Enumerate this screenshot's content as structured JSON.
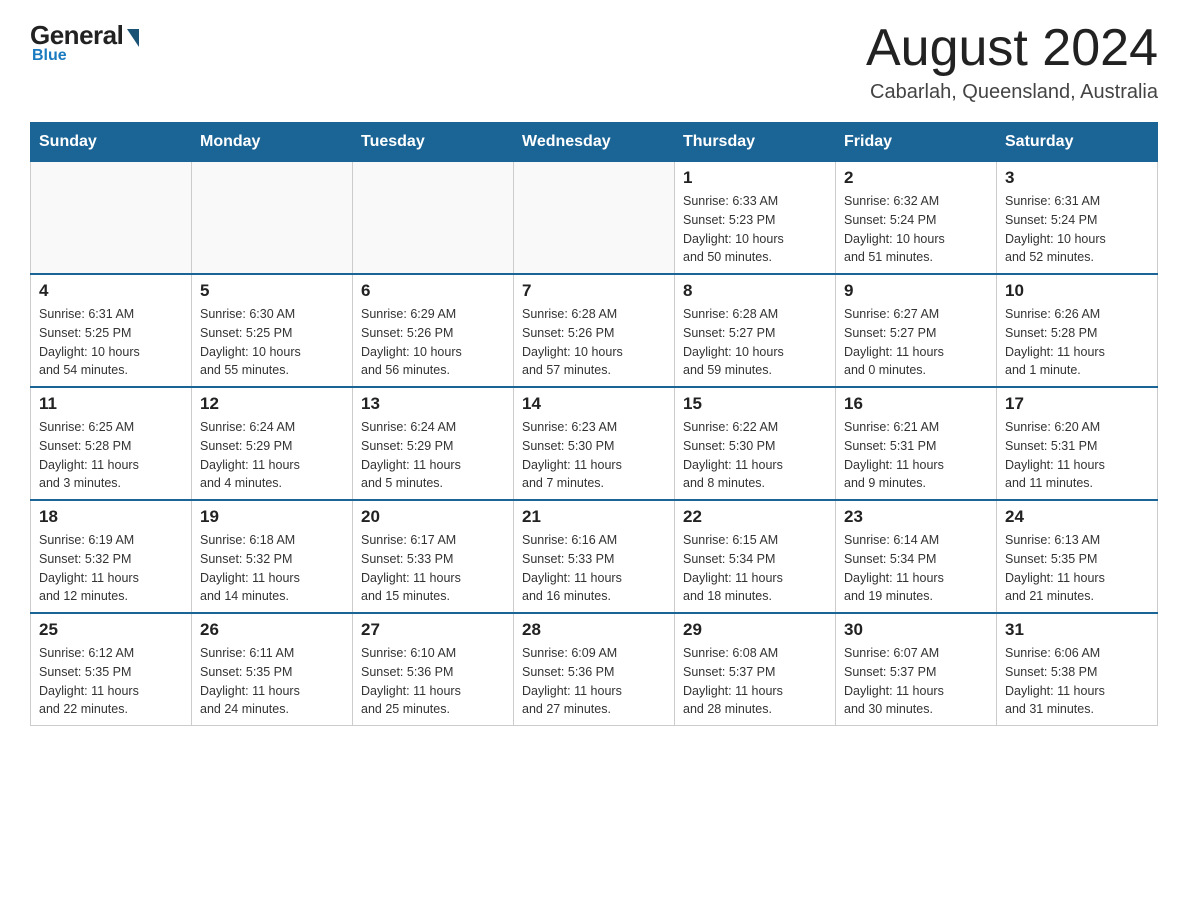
{
  "logo": {
    "general": "General",
    "blue": "Blue",
    "tagline": "Blue"
  },
  "header": {
    "month_year": "August 2024",
    "location": "Cabarlah, Queensland, Australia"
  },
  "days_of_week": [
    "Sunday",
    "Monday",
    "Tuesday",
    "Wednesday",
    "Thursday",
    "Friday",
    "Saturday"
  ],
  "weeks": [
    [
      {
        "day": "",
        "info": ""
      },
      {
        "day": "",
        "info": ""
      },
      {
        "day": "",
        "info": ""
      },
      {
        "day": "",
        "info": ""
      },
      {
        "day": "1",
        "info": "Sunrise: 6:33 AM\nSunset: 5:23 PM\nDaylight: 10 hours\nand 50 minutes."
      },
      {
        "day": "2",
        "info": "Sunrise: 6:32 AM\nSunset: 5:24 PM\nDaylight: 10 hours\nand 51 minutes."
      },
      {
        "day": "3",
        "info": "Sunrise: 6:31 AM\nSunset: 5:24 PM\nDaylight: 10 hours\nand 52 minutes."
      }
    ],
    [
      {
        "day": "4",
        "info": "Sunrise: 6:31 AM\nSunset: 5:25 PM\nDaylight: 10 hours\nand 54 minutes."
      },
      {
        "day": "5",
        "info": "Sunrise: 6:30 AM\nSunset: 5:25 PM\nDaylight: 10 hours\nand 55 minutes."
      },
      {
        "day": "6",
        "info": "Sunrise: 6:29 AM\nSunset: 5:26 PM\nDaylight: 10 hours\nand 56 minutes."
      },
      {
        "day": "7",
        "info": "Sunrise: 6:28 AM\nSunset: 5:26 PM\nDaylight: 10 hours\nand 57 minutes."
      },
      {
        "day": "8",
        "info": "Sunrise: 6:28 AM\nSunset: 5:27 PM\nDaylight: 10 hours\nand 59 minutes."
      },
      {
        "day": "9",
        "info": "Sunrise: 6:27 AM\nSunset: 5:27 PM\nDaylight: 11 hours\nand 0 minutes."
      },
      {
        "day": "10",
        "info": "Sunrise: 6:26 AM\nSunset: 5:28 PM\nDaylight: 11 hours\nand 1 minute."
      }
    ],
    [
      {
        "day": "11",
        "info": "Sunrise: 6:25 AM\nSunset: 5:28 PM\nDaylight: 11 hours\nand 3 minutes."
      },
      {
        "day": "12",
        "info": "Sunrise: 6:24 AM\nSunset: 5:29 PM\nDaylight: 11 hours\nand 4 minutes."
      },
      {
        "day": "13",
        "info": "Sunrise: 6:24 AM\nSunset: 5:29 PM\nDaylight: 11 hours\nand 5 minutes."
      },
      {
        "day": "14",
        "info": "Sunrise: 6:23 AM\nSunset: 5:30 PM\nDaylight: 11 hours\nand 7 minutes."
      },
      {
        "day": "15",
        "info": "Sunrise: 6:22 AM\nSunset: 5:30 PM\nDaylight: 11 hours\nand 8 minutes."
      },
      {
        "day": "16",
        "info": "Sunrise: 6:21 AM\nSunset: 5:31 PM\nDaylight: 11 hours\nand 9 minutes."
      },
      {
        "day": "17",
        "info": "Sunrise: 6:20 AM\nSunset: 5:31 PM\nDaylight: 11 hours\nand 11 minutes."
      }
    ],
    [
      {
        "day": "18",
        "info": "Sunrise: 6:19 AM\nSunset: 5:32 PM\nDaylight: 11 hours\nand 12 minutes."
      },
      {
        "day": "19",
        "info": "Sunrise: 6:18 AM\nSunset: 5:32 PM\nDaylight: 11 hours\nand 14 minutes."
      },
      {
        "day": "20",
        "info": "Sunrise: 6:17 AM\nSunset: 5:33 PM\nDaylight: 11 hours\nand 15 minutes."
      },
      {
        "day": "21",
        "info": "Sunrise: 6:16 AM\nSunset: 5:33 PM\nDaylight: 11 hours\nand 16 minutes."
      },
      {
        "day": "22",
        "info": "Sunrise: 6:15 AM\nSunset: 5:34 PM\nDaylight: 11 hours\nand 18 minutes."
      },
      {
        "day": "23",
        "info": "Sunrise: 6:14 AM\nSunset: 5:34 PM\nDaylight: 11 hours\nand 19 minutes."
      },
      {
        "day": "24",
        "info": "Sunrise: 6:13 AM\nSunset: 5:35 PM\nDaylight: 11 hours\nand 21 minutes."
      }
    ],
    [
      {
        "day": "25",
        "info": "Sunrise: 6:12 AM\nSunset: 5:35 PM\nDaylight: 11 hours\nand 22 minutes."
      },
      {
        "day": "26",
        "info": "Sunrise: 6:11 AM\nSunset: 5:35 PM\nDaylight: 11 hours\nand 24 minutes."
      },
      {
        "day": "27",
        "info": "Sunrise: 6:10 AM\nSunset: 5:36 PM\nDaylight: 11 hours\nand 25 minutes."
      },
      {
        "day": "28",
        "info": "Sunrise: 6:09 AM\nSunset: 5:36 PM\nDaylight: 11 hours\nand 27 minutes."
      },
      {
        "day": "29",
        "info": "Sunrise: 6:08 AM\nSunset: 5:37 PM\nDaylight: 11 hours\nand 28 minutes."
      },
      {
        "day": "30",
        "info": "Sunrise: 6:07 AM\nSunset: 5:37 PM\nDaylight: 11 hours\nand 30 minutes."
      },
      {
        "day": "31",
        "info": "Sunrise: 6:06 AM\nSunset: 5:38 PM\nDaylight: 11 hours\nand 31 minutes."
      }
    ]
  ]
}
